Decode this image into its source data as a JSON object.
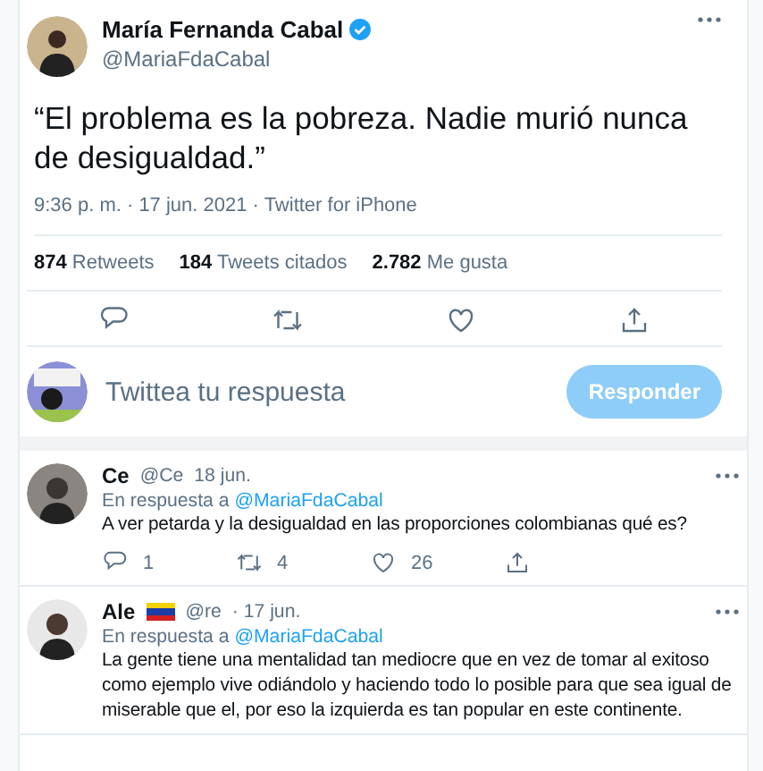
{
  "tweet": {
    "author": "María Fernanda Cabal",
    "verified": true,
    "handle": "@MariaFdaCabal",
    "text": "“El problema es la pobreza. Nadie murió nunca de desigualdad.”",
    "meta": "9:36 p. m. · 17 jun. 2021 · Twitter for iPhone",
    "stats": [
      {
        "count": "874",
        "label": "Retweets"
      },
      {
        "count": "184",
        "label": "Tweets citados"
      },
      {
        "count": "2.782",
        "label": "Me gusta"
      }
    ]
  },
  "composer": {
    "placeholder": "Twittea tu respuesta",
    "button": "Responder",
    "disabled": true
  },
  "replies": [
    {
      "name": "Ce",
      "handle": "@Ce",
      "date": "18 jun.",
      "reply_to_label": "En respuesta a",
      "reply_to": "@MariaFdaCabal",
      "text": "A ver petarda y la desigualdad en las proporciones colombianas qué es?",
      "counts": {
        "replies": "1",
        "retweets": "4",
        "likes": "26"
      }
    },
    {
      "name": "Ale",
      "flag": true,
      "handle": "@re",
      "date": "· 17 jun.",
      "reply_to_label": "En respuesta a",
      "reply_to": "@MariaFdaCabal",
      "text": "La gente tiene una mentalidad tan mediocre que en vez de tomar al exitoso como ejemplo vive odiándolo y haciendo todo lo posible para que sea igual de miserable que el, por eso la izquierda es tan popular en este continente."
    }
  ]
}
